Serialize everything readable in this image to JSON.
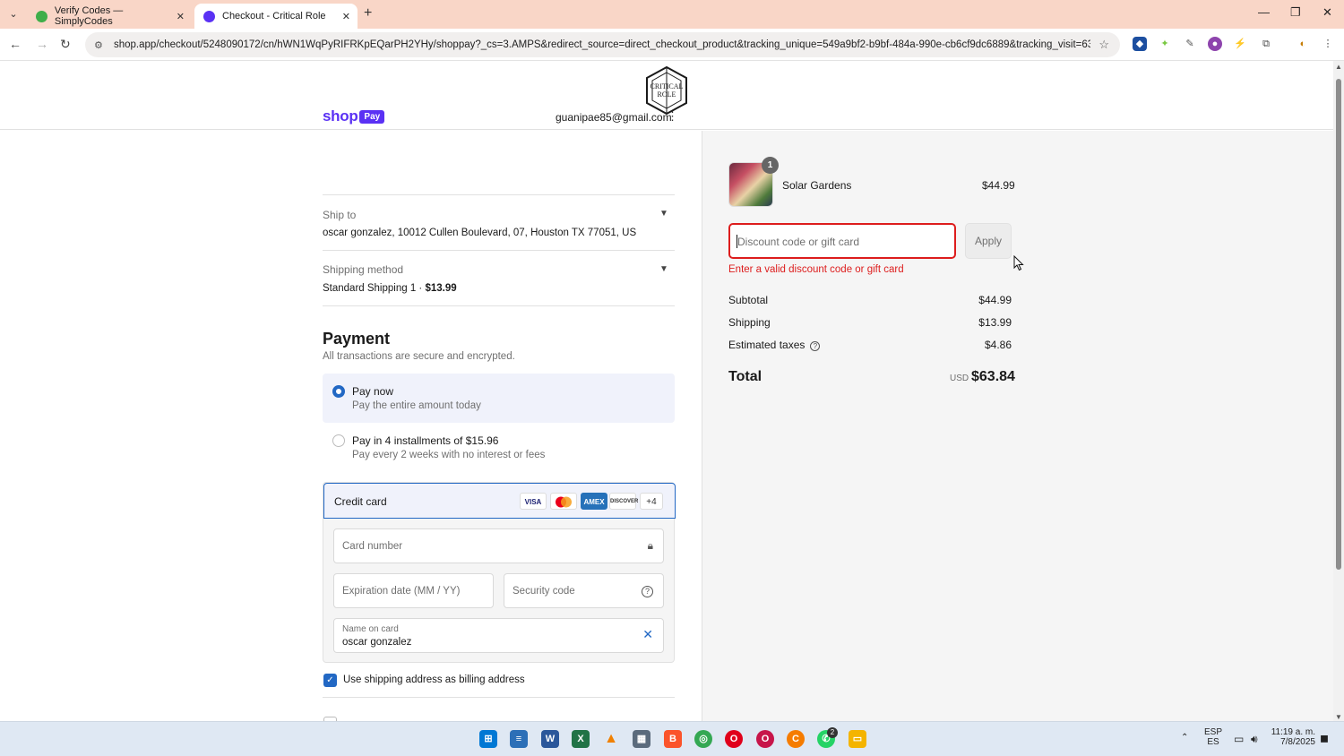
{
  "browser": {
    "tabs": [
      {
        "title": "Verify Codes — SimplyCodes",
        "active": false
      },
      {
        "title": "Checkout - Critical Role",
        "active": true
      }
    ],
    "url": "shop.app/checkout/5248090172/cn/hWN1WqPyRIFRKpEQarPH2YHy/shoppay?_cs=3.AMPS&redirect_source=direct_checkout_product&tracking_unique=549a9bf2-b9bf-484a-990e-cb6cf9dc6889&tracking_visit=63d57357-637..."
  },
  "header": {
    "logo_text": "Critical Role"
  },
  "account": {
    "shop_text": "shop",
    "pay_text": "Pay",
    "email": "guanipae85@gmail.com"
  },
  "ship_to": {
    "label": "Ship to",
    "address": "oscar gonzalez, 10012 Cullen Boulevard, 07, Houston TX 77051, US"
  },
  "shipping_method": {
    "label": "Shipping method",
    "value": "Standard Shipping 1",
    "price": "$13.99"
  },
  "payment": {
    "heading": "Payment",
    "subtitle": "All transactions are secure and encrypted.",
    "options": [
      {
        "title": "Pay now",
        "subtitle": "Pay the entire amount today",
        "selected": true
      },
      {
        "title": "Pay in 4 installments of $15.96",
        "subtitle": "Pay every 2 weeks with no interest or fees",
        "selected": false
      }
    ],
    "credit_card": {
      "label": "Credit card",
      "brands": [
        "VISA",
        "MC",
        "AMEX",
        "DISCOVER"
      ],
      "more_brands": "+4",
      "card_number_placeholder": "Card number",
      "expiry_placeholder": "Expiration date (MM / YY)",
      "security_placeholder": "Security code",
      "name_label": "Name on card",
      "name_value": "oscar gonzalez"
    },
    "billing_checkbox_label": "Use shipping address as billing address"
  },
  "order": {
    "item": {
      "name": "Solar Gardens",
      "price": "$44.99",
      "quantity": "1"
    },
    "discount": {
      "placeholder": "Discount code or gift card",
      "apply_label": "Apply",
      "error": "Enter a valid discount code or gift card"
    },
    "summary": [
      {
        "label": "Subtotal",
        "value": "$44.99"
      },
      {
        "label": "Shipping",
        "value": "$13.99"
      },
      {
        "label": "Estimated taxes",
        "value": "$4.86"
      }
    ],
    "total_label": "Total",
    "currency": "USD",
    "total_value": "$63.84"
  },
  "taskbar": {
    "lang_top": "ESP",
    "lang_bottom": "ES",
    "time": "11:19 a. m.",
    "date": "7/8/2025",
    "whatsapp_badge": "2"
  },
  "colors": {
    "accent": "#2268c4",
    "error": "#dd1d1d",
    "shop_pay": "#5a31f4"
  }
}
